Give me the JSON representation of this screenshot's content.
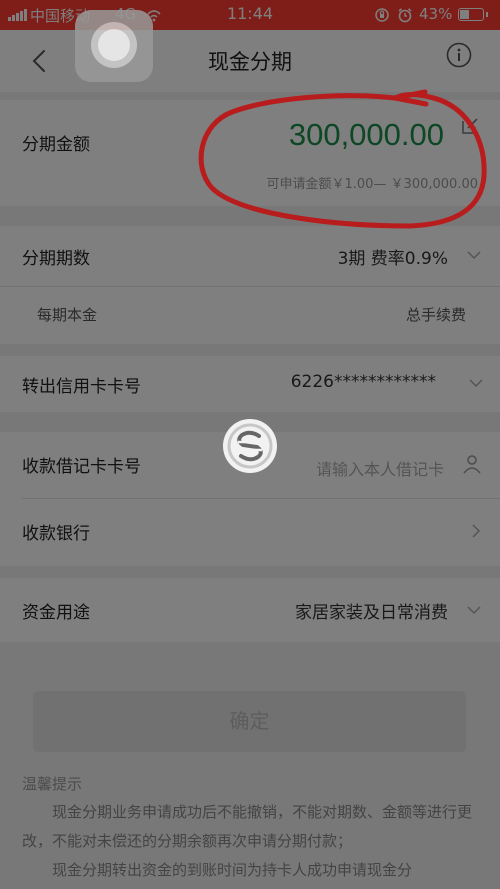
{
  "colors": {
    "status_bar": "#ff3b30",
    "amount_green": "#1d8f4a",
    "annotation_red": "#b81c1c",
    "page_bg": "#f0f0f0"
  },
  "status_bar": {
    "carrier": "中国移动",
    "network": "4G",
    "time": "11:44",
    "battery_percent": "43%",
    "battery_level": 0.43
  },
  "navbar": {
    "title": "现金分期",
    "back_icon": "chevron-left-icon",
    "info_icon": "info-circle-icon"
  },
  "amount_section": {
    "label": "分期金额",
    "amount": "300,000.00",
    "range_hint": "可申请金额￥1.00— ￥300,000.00",
    "edit_icon": "edit-icon"
  },
  "term_section": {
    "label": "分期期数",
    "value": "3期 费率0.9%",
    "sub_left": "每期本金",
    "sub_right": "总手续费"
  },
  "credit_card": {
    "label": "转出信用卡卡号",
    "value": "6226************"
  },
  "debit_card": {
    "label": "收款借记卡卡号",
    "placeholder": "请输入本人借记卡"
  },
  "bank": {
    "label": "收款银行"
  },
  "purpose": {
    "label": "资金用途",
    "value": "家居家装及日常消费"
  },
  "confirm_button": "确定",
  "tips": {
    "title": "温馨提示",
    "paragraph1": "现金分期业务申请成功后不能撤销，不能对期数、金额等进行更改，不能对未偿还的分期余额再次申请分期付款；",
    "paragraph2": "现金分期转出资金的到账时间为持卡人成功申请现金分"
  }
}
